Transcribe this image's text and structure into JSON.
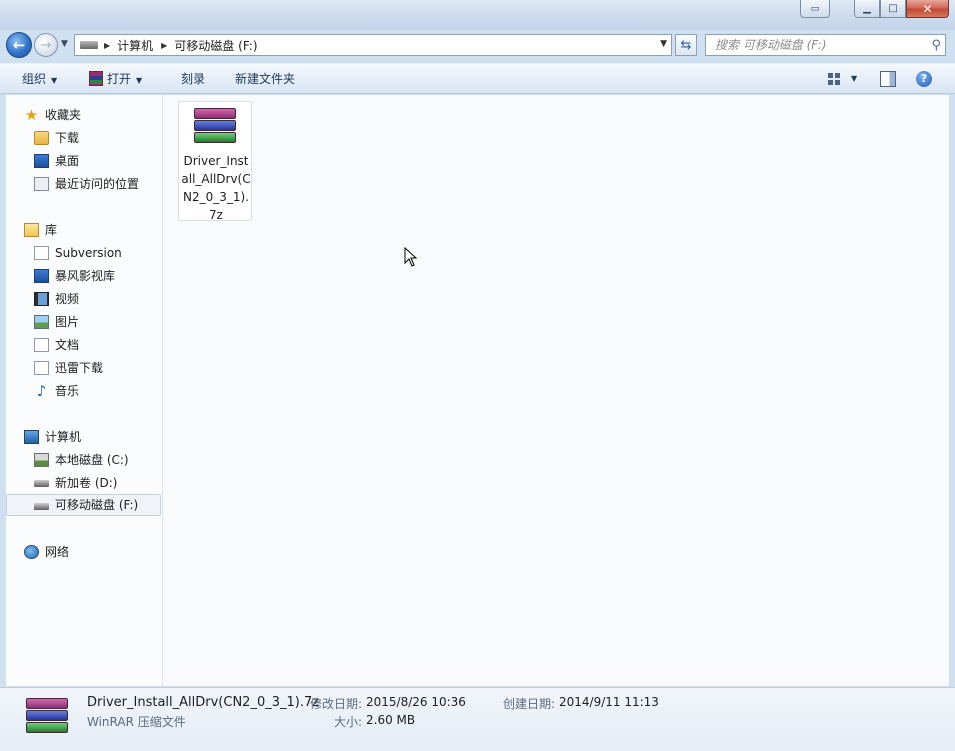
{
  "window": {
    "controls": {
      "minimize": "▁",
      "maximize": "□",
      "close": "✕",
      "extra": "▭"
    }
  },
  "navigation": {
    "back_glyph": "←",
    "forward_glyph": "→",
    "breadcrumbs": [
      "计算机",
      "可移动磁盘 (F:)"
    ],
    "search_placeholder": "搜索 可移动磁盘 (F:)"
  },
  "toolbar": {
    "organize": "组织",
    "open": "打开",
    "burn": "刻录",
    "new_folder": "新建文件夹",
    "help": "?"
  },
  "sidebar": {
    "favorites": {
      "label": "收藏夹",
      "items": [
        "下载",
        "桌面",
        "最近访问的位置"
      ]
    },
    "libraries": {
      "label": "库",
      "items": [
        "Subversion",
        "暴风影视库",
        "视频",
        "图片",
        "文档",
        "迅雷下载",
        "音乐"
      ]
    },
    "computer": {
      "label": "计算机",
      "items": [
        "本地磁盘 (C:)",
        "新加卷 (D:)",
        "可移动磁盘 (F:)"
      ],
      "selected": "可移动磁盘 (F:)"
    },
    "network": {
      "label": "网络"
    }
  },
  "files": [
    {
      "name": "Driver_Install_AllDrv(CN2_0_3_1).7z",
      "icon": "winrar-archive-icon"
    }
  ],
  "details": {
    "filename": "Driver_Install_AllDrv(CN2_0_3_1).7z",
    "type": "WinRAR 压缩文件",
    "modified_label": "修改日期:",
    "modified_value": "2015/8/26 10:36",
    "created_label": "创建日期:",
    "created_value": "2014/9/11 11:13",
    "size_label": "大小:",
    "size_value": "2.60 MB"
  },
  "colors": {
    "accent": "#2f74c8",
    "rar_magenta": "#a33a86",
    "rar_blue": "#2f43a8",
    "rar_green": "#2f9a3d"
  }
}
